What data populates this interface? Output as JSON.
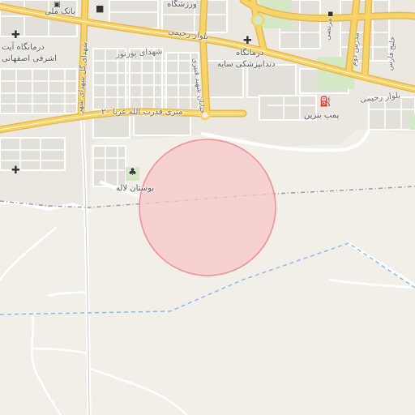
{
  "labels": {
    "bank_melli": "بانک ملی",
    "varzeshgah": "ورزشگاه",
    "boulevard_rahimi_top": "بلوار رحیمی",
    "shohada_pourvar": "شهدای پورنور",
    "dentistry": "دندانپزشکی سایه",
    "darmangah_right": "درمانگاه",
    "darmangah_left": "درمانگاه آیت",
    "ashrafi": "اشرفی اصفهانی",
    "boulevard_rahimi_right": "بلوار رحیمی",
    "gas_station": "پمپ بنزین",
    "street_20m": "۲۰ متری قدرت الله غربا",
    "boostan_laleh": "بوستان لاله",
    "vertical_shahid": "شهدای گل شهدای شهر",
    "vertical_main": "خیابان شهید قنبری",
    "vertical_right_1": "مرتضی",
    "vertical_right_2": "مدرس دوم",
    "vertical_right_3": "خلیج فارس"
  },
  "icons": {
    "bank": "bank-icon",
    "hospital": "hospital-cross-icon",
    "fuel": "fuel-pump-icon",
    "park": "tree-icon",
    "mosque": "mosque-icon"
  },
  "colors": {
    "land": "#f2efe9",
    "major_road": "#f7d36b",
    "major_road_casing": "#e6b94a",
    "minor_road": "#ffffff",
    "block": "#e6e3dc",
    "park": "#d4e8c6",
    "circle_fill": "#f8c7c9",
    "circle_stroke": "#f08d93",
    "boundary": "#9a9aa8",
    "water_line": "#8fb8e6"
  }
}
